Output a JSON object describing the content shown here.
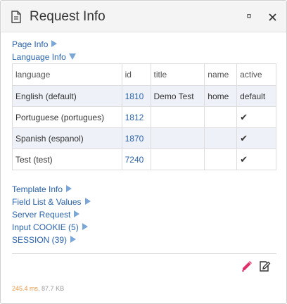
{
  "header": {
    "title": "Request Info",
    "pin_glyph": "¤"
  },
  "links": {
    "page_info": "Page Info",
    "language_info": "Language Info",
    "template_info": "Template Info",
    "field_list": "Field List & Values",
    "server_request": "Server Request",
    "input_cookie": "Input COOKIE (5)",
    "session": "SESSION (39)"
  },
  "table": {
    "headers": [
      "language",
      "id",
      "title",
      "name",
      "active"
    ],
    "rows": [
      {
        "language": "English (default)",
        "id": "1810",
        "title": "Demo Test",
        "name": "home",
        "active": "default"
      },
      {
        "language": "Portuguese (portugues)",
        "id": "1812",
        "title": "",
        "name": "",
        "active": "✔"
      },
      {
        "language": "Spanish (espanol)",
        "id": "1870",
        "title": "",
        "name": "",
        "active": "✔"
      },
      {
        "language": "Test (test)",
        "id": "7240",
        "title": "",
        "name": "",
        "active": "✔"
      }
    ]
  },
  "footer": {
    "time": "245.4 ms",
    "sep": ", ",
    "size": "87.7 KB"
  },
  "colors": {
    "link": "#2a62a8",
    "arrow": "#7aa6d8",
    "edit_icon": "#e0306a",
    "time": "#e59a4a"
  },
  "icons": [
    "document-icon",
    "pin-icon",
    "close-icon",
    "pencil-icon",
    "edit-document-icon"
  ]
}
